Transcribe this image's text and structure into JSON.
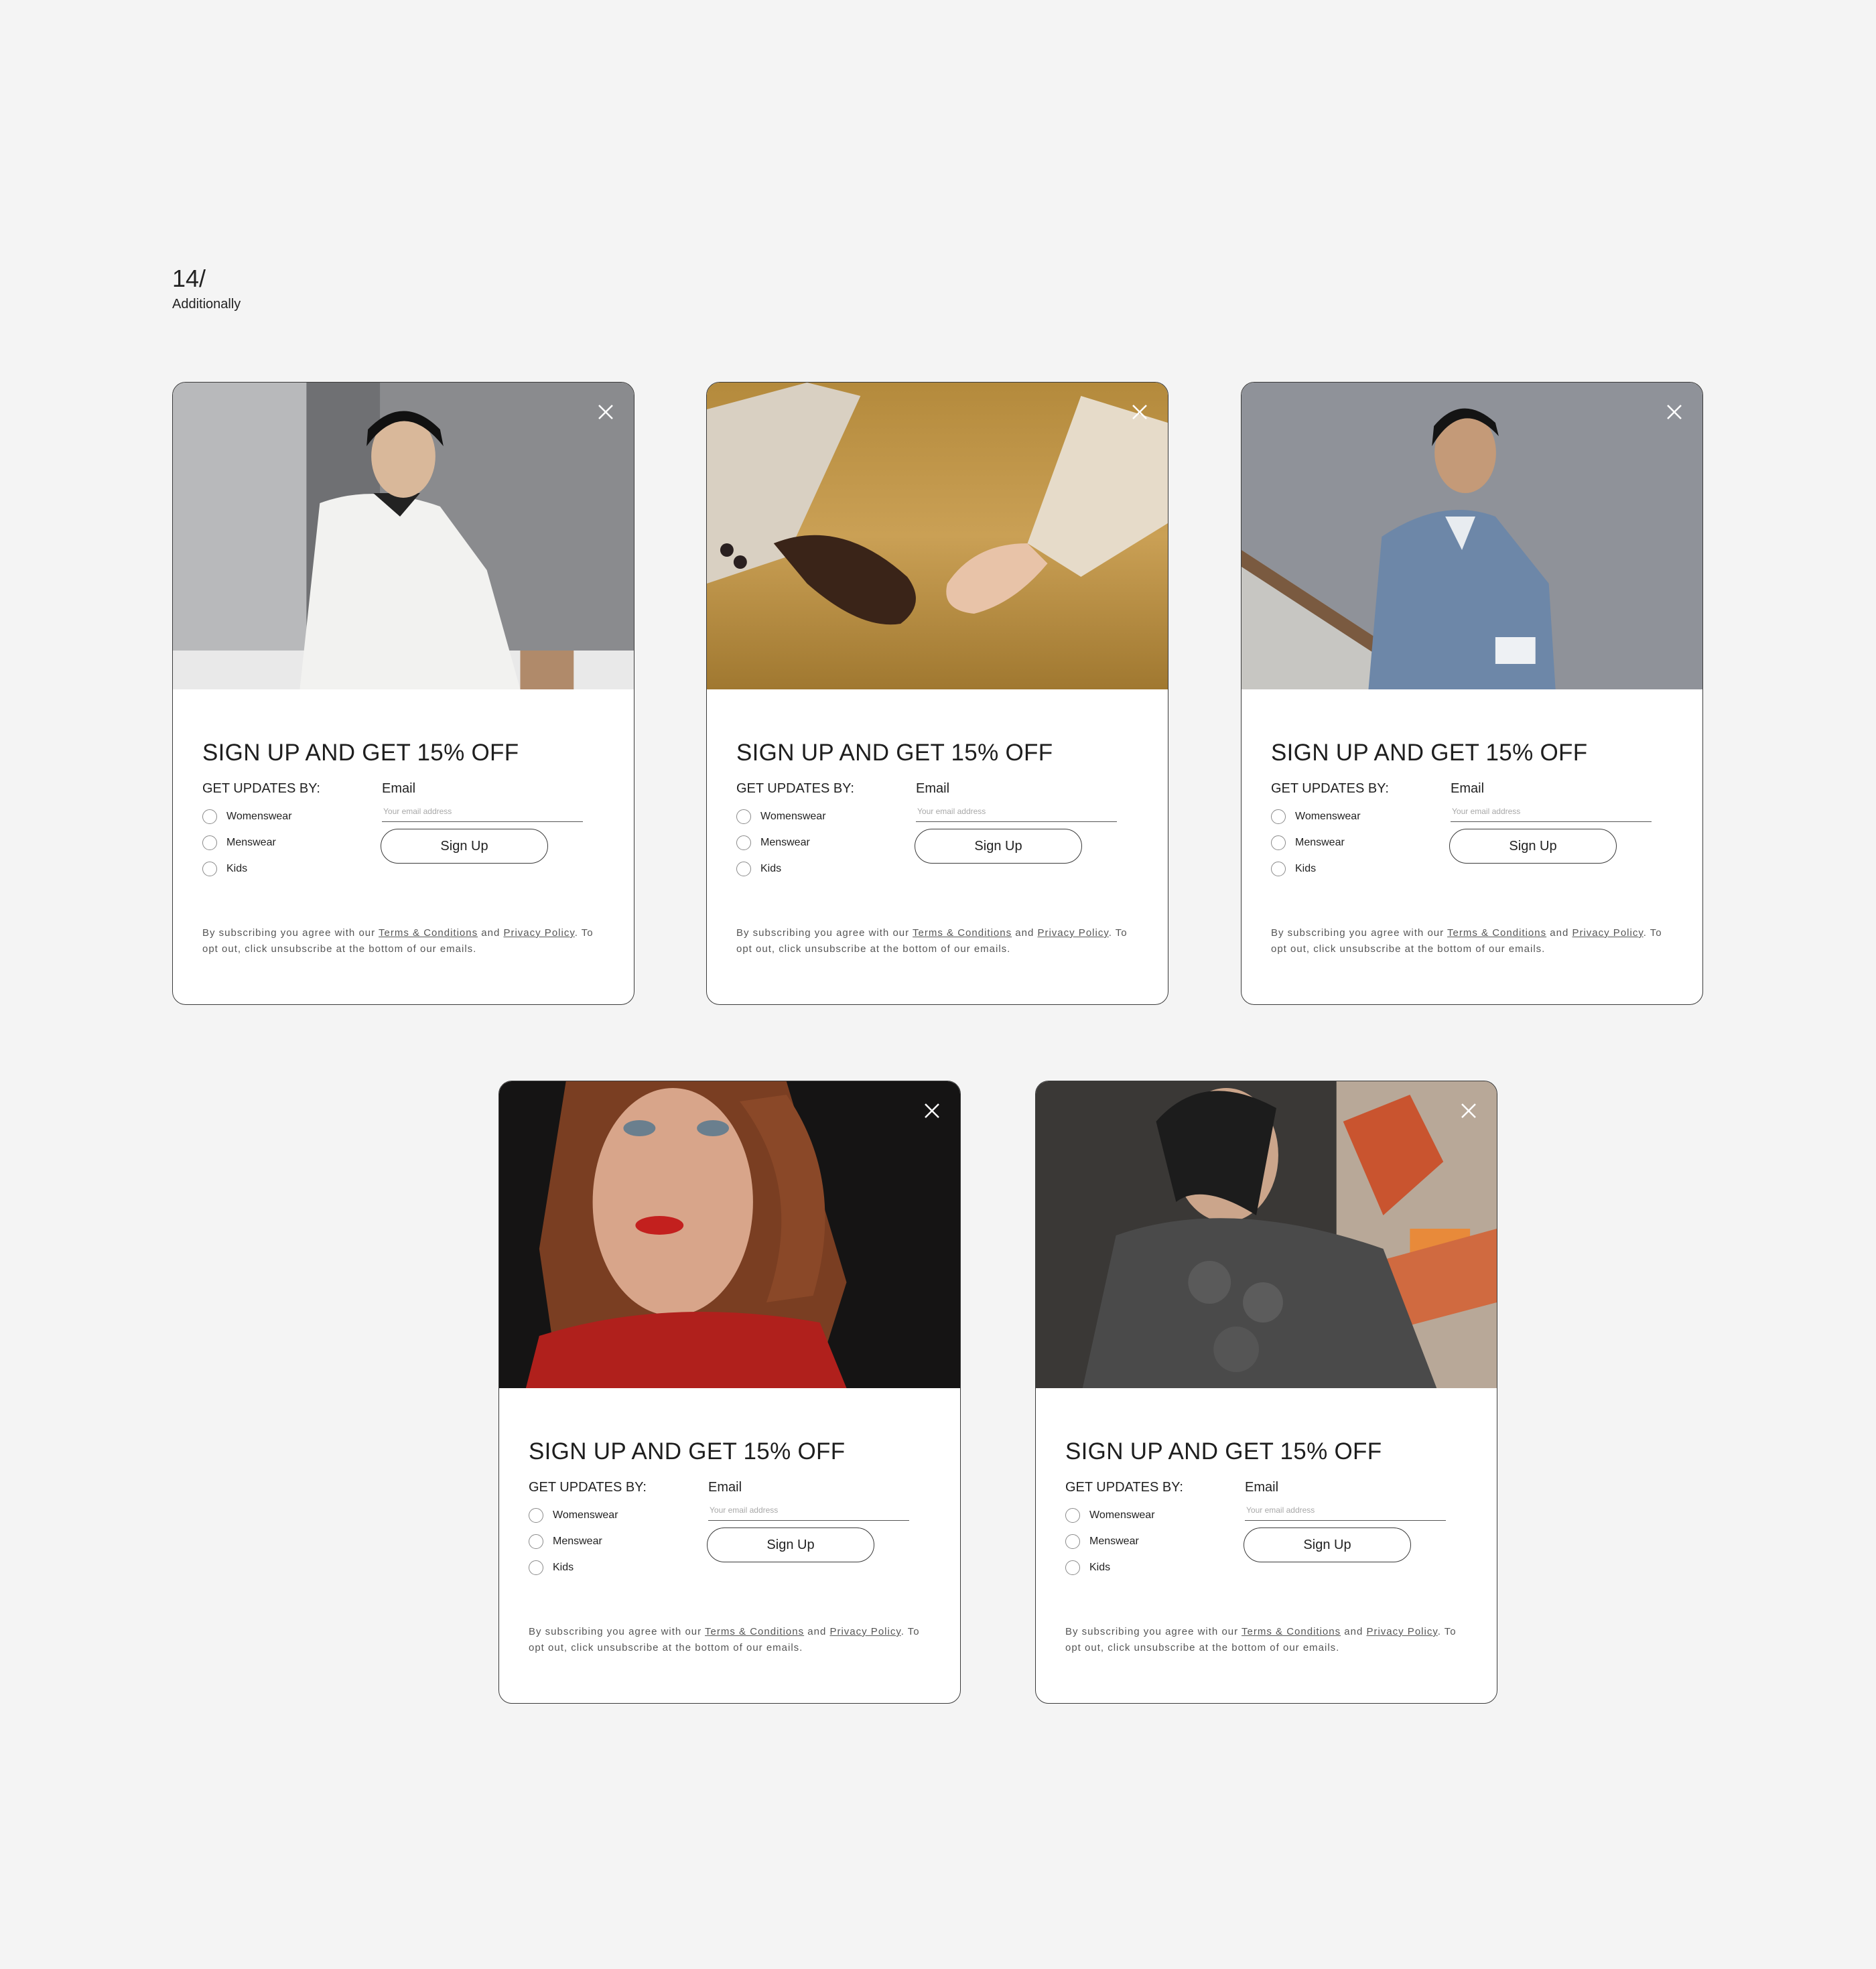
{
  "section": {
    "number": "14/",
    "subtitle": "Additionally"
  },
  "colors": {
    "background": "#f4f4f4",
    "card": "#ffffff",
    "border": "#3a3a3a",
    "text": "#222222"
  },
  "popups": [
    {
      "image": "man-white-coat-photo",
      "close_icon": "close-icon",
      "title": "SIGN UP AND GET 15% OFF",
      "updates_label": "GET UPDATES BY:",
      "options": [
        "Womenswear",
        "Menswear",
        "Kids"
      ],
      "email_label": "Email",
      "email_placeholder": "Your email address",
      "button_label": "Sign Up",
      "legal_prefix": "By subscribing you agree with our",
      "terms_link": "Terms & Conditions",
      "and_text": "and",
      "privacy_link": "Privacy Policy",
      "legal_suffix": ". To opt out, click unsubscribe at the bottom of our emails."
    },
    {
      "image": "hands-wheat-field-photo",
      "close_icon": "close-icon",
      "title": "SIGN UP AND GET 15% OFF",
      "updates_label": "GET UPDATES BY:",
      "options": [
        "Womenswear",
        "Menswear",
        "Kids"
      ],
      "email_label": "Email",
      "email_placeholder": "Your email address",
      "button_label": "Sign Up",
      "legal_prefix": "By subscribing you agree with our",
      "terms_link": "Terms & Conditions",
      "and_text": "and",
      "privacy_link": "Privacy Policy",
      "legal_suffix": ". To opt out, click unsubscribe at the bottom of our emails."
    },
    {
      "image": "man-blue-jacket-photo",
      "close_icon": "close-icon",
      "title": "SIGN UP AND GET 15% OFF",
      "updates_label": "GET UPDATES BY:",
      "options": [
        "Womenswear",
        "Menswear",
        "Kids"
      ],
      "email_label": "Email",
      "email_placeholder": "Your email address",
      "button_label": "Sign Up",
      "legal_prefix": "By subscribing you agree with our",
      "terms_link": "Terms & Conditions",
      "and_text": "and",
      "privacy_link": "Privacy Policy",
      "legal_suffix": ". To opt out, click unsubscribe at the bottom of our emails."
    },
    {
      "image": "woman-red-lips-photo",
      "close_icon": "close-icon",
      "title": "SIGN UP AND GET 15% OFF",
      "updates_label": "GET UPDATES BY:",
      "options": [
        "Womenswear",
        "Menswear",
        "Kids"
      ],
      "email_label": "Email",
      "email_placeholder": "Your email address",
      "button_label": "Sign Up",
      "legal_prefix": "By subscribing you agree with our",
      "terms_link": "Terms & Conditions",
      "and_text": "and",
      "privacy_link": "Privacy Policy",
      "legal_suffix": ". To opt out, click unsubscribe at the bottom of our emails."
    },
    {
      "image": "woman-graffiti-photo",
      "close_icon": "close-icon",
      "title": "SIGN UP AND GET 15% OFF",
      "updates_label": "GET UPDATES BY:",
      "options": [
        "Womenswear",
        "Menswear",
        "Kids"
      ],
      "email_label": "Email",
      "email_placeholder": "Your email address",
      "button_label": "Sign Up",
      "legal_prefix": "By subscribing you agree with our",
      "terms_link": "Terms & Conditions",
      "and_text": "and",
      "privacy_link": "Privacy Policy",
      "legal_suffix": ". To opt out, click unsubscribe at the bottom of our emails."
    }
  ]
}
